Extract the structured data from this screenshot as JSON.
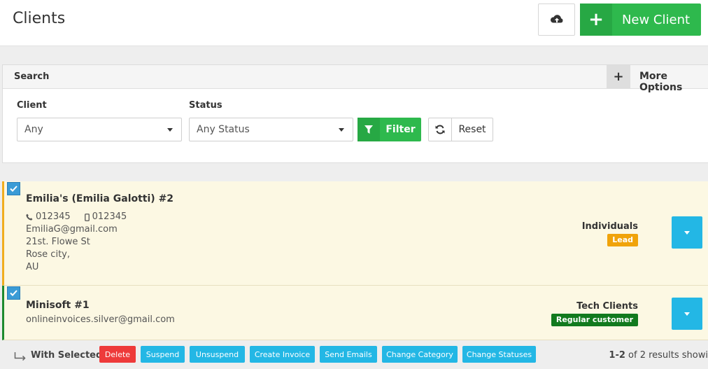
{
  "header": {
    "title": "Clients",
    "upload_icon": "cloud-upload-icon",
    "new_client_label": "New Client"
  },
  "search": {
    "title": "Search",
    "more_options_label": "More Options",
    "client_label": "Client",
    "client_value": "Any",
    "status_label": "Status",
    "status_value": "Any Status",
    "filter_label": "Filter",
    "reset_label": "Reset"
  },
  "clients": [
    {
      "name": "Emilia's (Emilia Galotti) #2",
      "phone": "012345",
      "mobile": "012345",
      "email": "EmiliaG@gmail.com",
      "address1": "21st. Flowe St",
      "address2": "Rose city,",
      "address3": "AU",
      "category": "Individuals",
      "status": "Lead",
      "status_color": "#f0a30a",
      "stripe_color": "#f0ad1e"
    },
    {
      "name": "Minisoft #1",
      "email": "onlineinvoices.silver@gmail.com",
      "category": "Tech Clients",
      "status": "Regular customer",
      "status_color": "#117a1e",
      "stripe_color": "#1e8a2e"
    }
  ],
  "bottom": {
    "with_selected": "With Selected",
    "actions": [
      "Delete",
      "Suspend",
      "Unsuspend",
      "Create Invoice",
      "Send Emails",
      "Change Category",
      "Change Statuses"
    ],
    "results_range": "1-2",
    "results_rest": " of 2 results showi"
  },
  "colors": {
    "green": "#2eb94d",
    "blue": "#23b7e5",
    "red": "#ee3a3a",
    "row_bg": "#fcf8e3"
  }
}
